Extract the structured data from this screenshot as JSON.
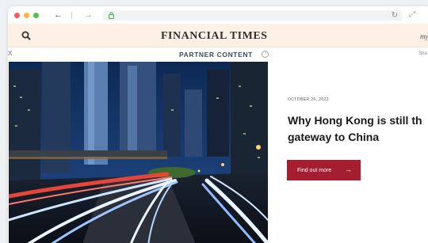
{
  "browser": {
    "back_icon": "arrow-left-icon",
    "back_glyph": "←",
    "forward_icon": "arrow-right-icon",
    "forward_glyph": "→",
    "lock_icon": "lock-icon",
    "reload_icon": "reload-icon",
    "reload_glyph": "↻",
    "expand_icon": "expand-icon",
    "expand_glyph": "⤢"
  },
  "header": {
    "masthead": "FINANCIAL TIMES",
    "right_text": "my",
    "search_icon": "search-icon",
    "background": "#fdf1e6"
  },
  "partner_bar": {
    "left_text": "X",
    "label": "PARTNER CONTENT",
    "info_glyph": "?",
    "right_text": "Sha"
  },
  "article": {
    "date": "OCTOBER 26, 2022",
    "title_line1": "Why Hong Kong is still th",
    "title_line2": "gateway to China",
    "cta_label": "Find out more",
    "cta_arrow": "→",
    "cta_color": "#a51d31"
  }
}
